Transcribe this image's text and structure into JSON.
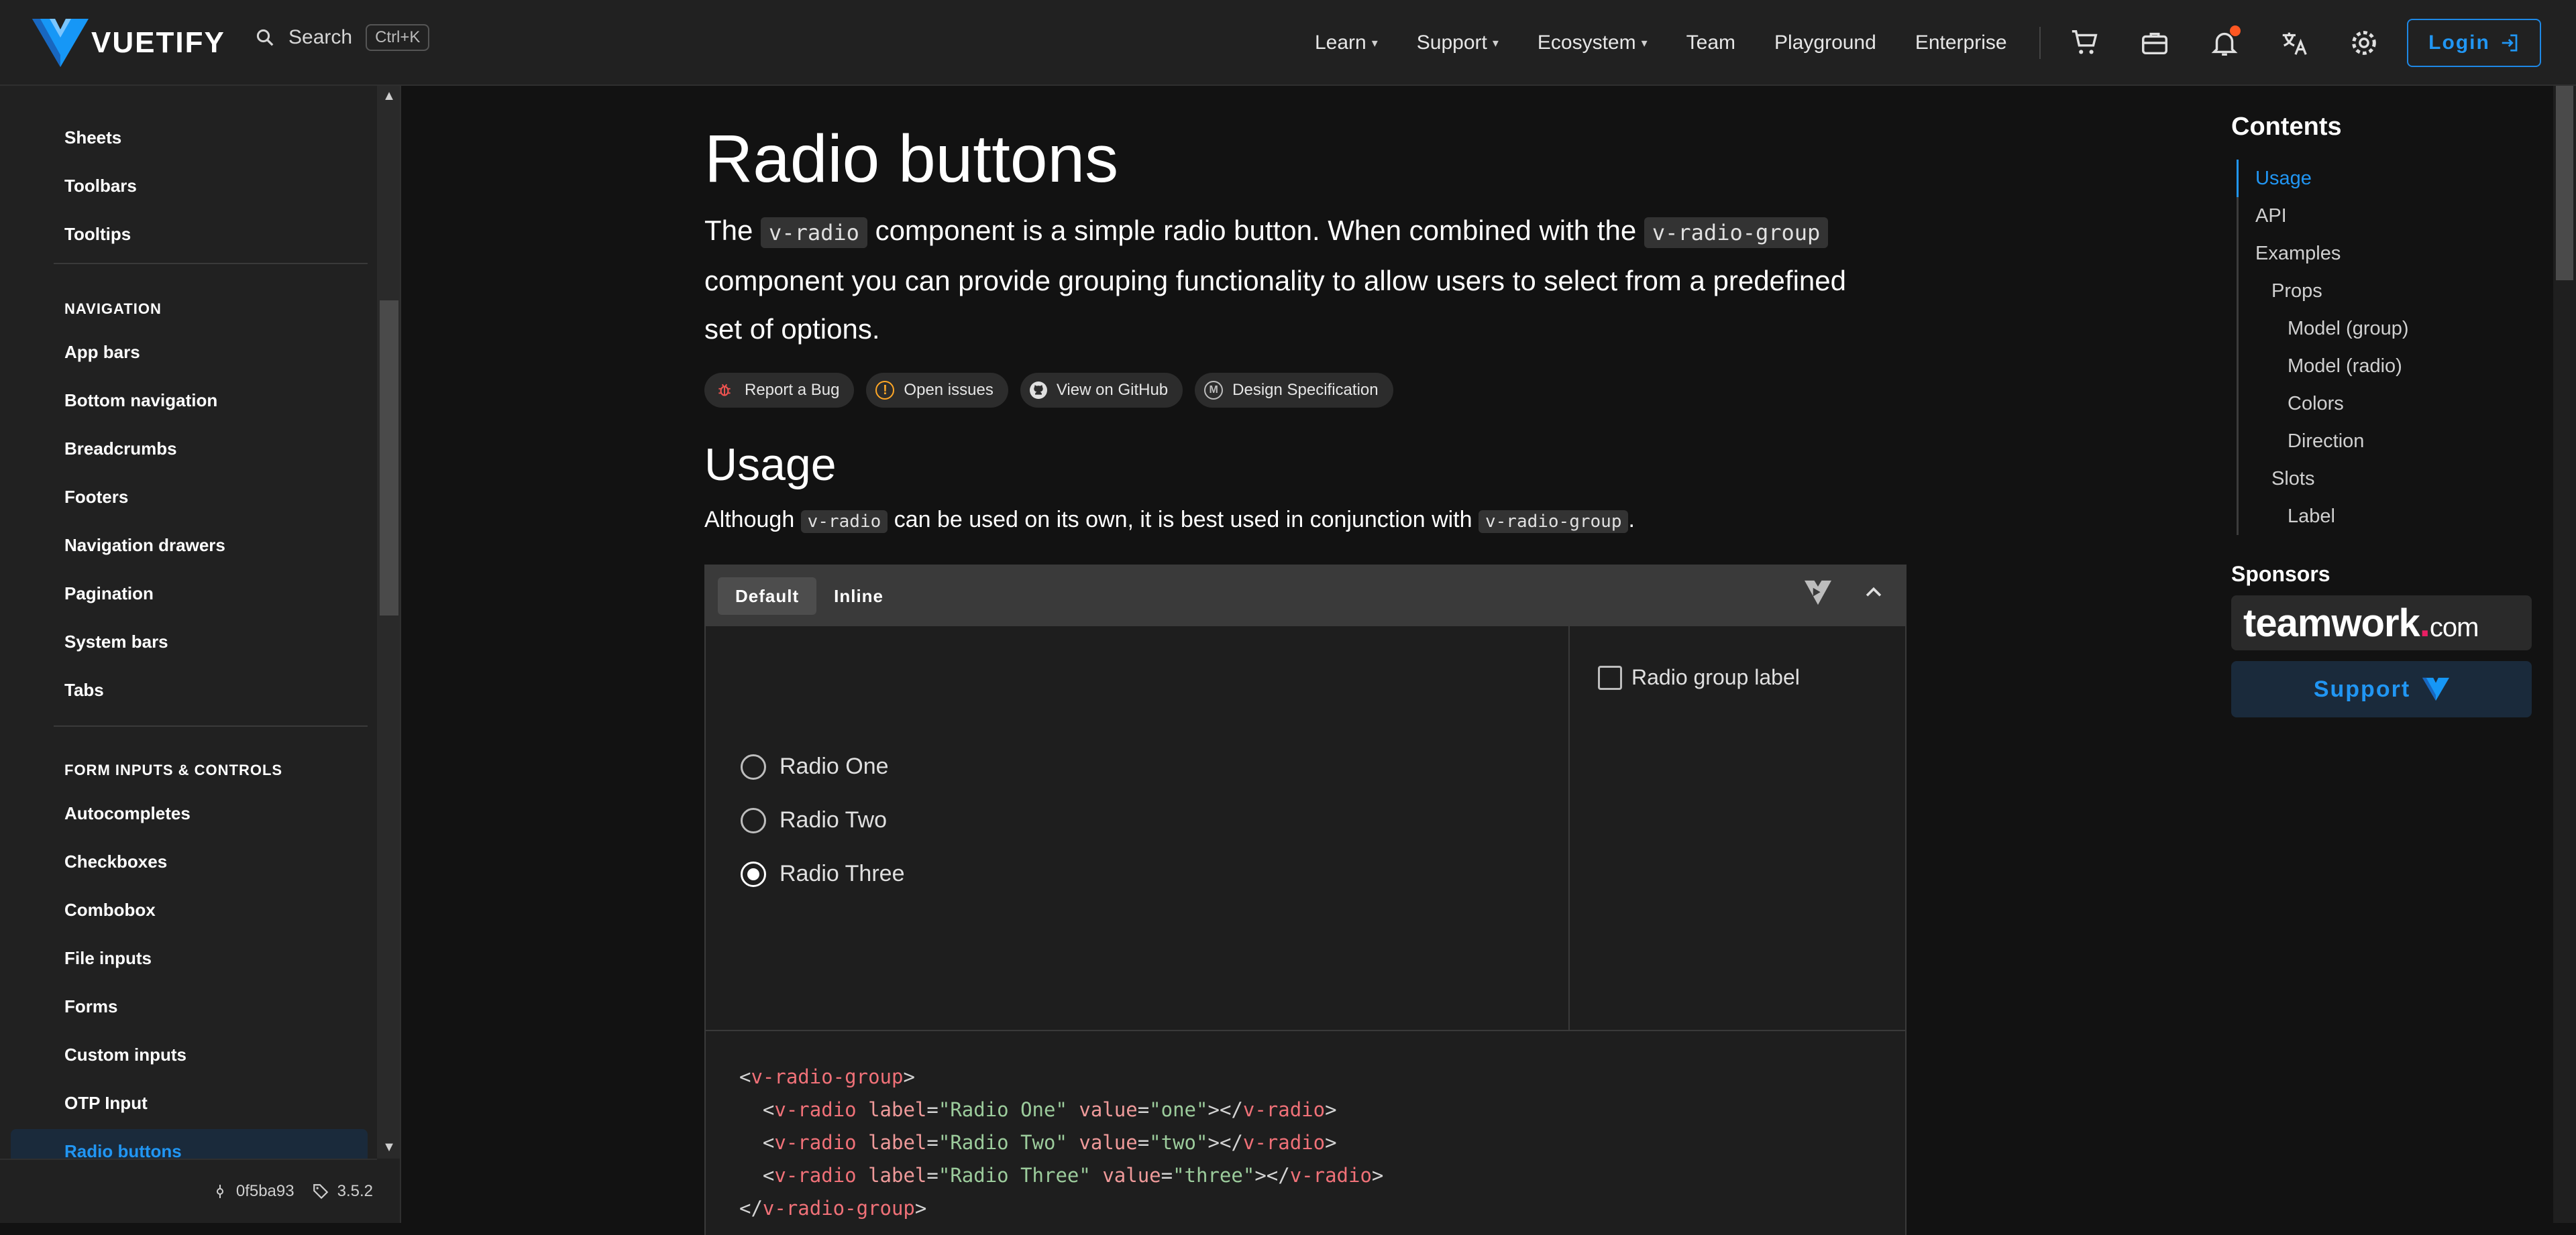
{
  "app": {
    "logo_text": "VUETIFY",
    "brand_color": "#1867c0",
    "accent_color": "#2196f3"
  },
  "header": {
    "search_label": "Search",
    "search_shortcut": "Ctrl+K",
    "nav": [
      {
        "label": "Learn",
        "has_menu": true
      },
      {
        "label": "Support",
        "has_menu": true
      },
      {
        "label": "Ecosystem",
        "has_menu": true
      },
      {
        "label": "Team",
        "has_menu": false
      },
      {
        "label": "Playground",
        "has_menu": false
      },
      {
        "label": "Enterprise",
        "has_menu": false
      }
    ],
    "icons": [
      "cart-icon",
      "briefcase-icon",
      "bell-icon",
      "translate-icon",
      "gear-icon"
    ],
    "login_label": "Login"
  },
  "sidebar": {
    "top_items": [
      "Sheets",
      "Toolbars",
      "Tooltips"
    ],
    "navigation_heading": "NAVIGATION",
    "navigation_items": [
      "App bars",
      "Bottom navigation",
      "Breadcrumbs",
      "Footers",
      "Navigation drawers",
      "Pagination",
      "System bars",
      "Tabs"
    ],
    "form_heading": "FORM INPUTS & CONTROLS",
    "form_items": [
      "Autocompletes",
      "Checkboxes",
      "Combobox",
      "File inputs",
      "Forms",
      "Custom inputs",
      "OTP Input",
      "Radio buttons"
    ],
    "active_item": "Radio buttons",
    "footer": {
      "commit": "0f5ba93",
      "version": "3.5.2"
    }
  },
  "main": {
    "title": "Radio buttons",
    "lead": {
      "p1": "The ",
      "code1": "v-radio",
      "p2": " component is a simple radio button. When combined with the ",
      "code2": "v-radio-group",
      "p3": " component you can provide grouping functionality to allow users to select from a predefined set of options."
    },
    "chips": [
      {
        "label": "Report a Bug",
        "icon": "bug-icon"
      },
      {
        "label": "Open issues",
        "icon": "alert-circle-icon"
      },
      {
        "label": "View on GitHub",
        "icon": "github-icon"
      },
      {
        "label": "Design Specification",
        "icon": "material-icon"
      }
    ],
    "usage": {
      "title": "Usage",
      "t1": "Although ",
      "code1": "v-radio",
      "t2": " can be used on its own, it is best used in conjunction with ",
      "code2": "v-radio-group",
      "t3": "."
    },
    "demo": {
      "tabs": [
        "Default",
        "Inline"
      ],
      "active_tab": "Default",
      "radios": [
        {
          "label": "Radio One",
          "checked": false
        },
        {
          "label": "Radio Two",
          "checked": false
        },
        {
          "label": "Radio Three",
          "checked": true
        }
      ],
      "option_checkbox": "Radio group label",
      "code": {
        "open_tag": "v-radio-group",
        "radio_tag": "v-radio",
        "label_attr": "label",
        "value_attr": "value",
        "rows": [
          {
            "label": "\"Radio One\"",
            "value": "\"one\""
          },
          {
            "label": "\"Radio Two\"",
            "value": "\"two\""
          },
          {
            "label": "\"Radio Three\"",
            "value": "\"three\""
          }
        ]
      }
    }
  },
  "toc": {
    "title": "Contents",
    "items": [
      {
        "label": "Usage",
        "level": 1,
        "active": true
      },
      {
        "label": "API",
        "level": 1
      },
      {
        "label": "Examples",
        "level": 1
      },
      {
        "label": "Props",
        "level": 2
      },
      {
        "label": "Model (group)",
        "level": 3
      },
      {
        "label": "Model (radio)",
        "level": 3
      },
      {
        "label": "Colors",
        "level": 3
      },
      {
        "label": "Direction",
        "level": 3
      },
      {
        "label": "Slots",
        "level": 2
      },
      {
        "label": "Label",
        "level": 3
      }
    ],
    "sponsors_title": "Sponsors",
    "sponsor": {
      "name": "teamwork",
      "dot": ".",
      "suffix": "com"
    },
    "support_label": "Support"
  }
}
